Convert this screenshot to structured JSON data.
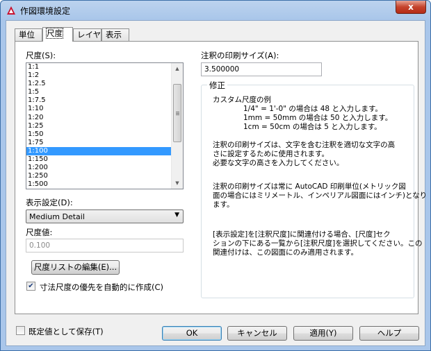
{
  "window": {
    "title": "作図環境設定",
    "close_glyph": "x"
  },
  "tabs": [
    {
      "label": "単位"
    },
    {
      "label": "尺度"
    },
    {
      "label": "レイヤ"
    },
    {
      "label": "表示"
    }
  ],
  "scale": {
    "label": "尺度(S):",
    "items": [
      "1:1",
      "1:2",
      "1:2.5",
      "1:5",
      "1:7.5",
      "1:10",
      "1:20",
      "1:25",
      "1:50",
      "1:75",
      "1:100",
      "1:150",
      "1:200",
      "1:250",
      "1:500"
    ],
    "selected": "1:100"
  },
  "display": {
    "label": "表示設定(D):",
    "value": "Medium Detail"
  },
  "scale_value": {
    "label": "尺度値:",
    "value": "0.100"
  },
  "edit_scale_list_button": "尺度リストの編集(E)...",
  "auto_dimscale": {
    "label": "寸法尺度の優先を自動的に作成(C)",
    "checked": true
  },
  "annotation_size": {
    "label": "注釈の印刷サイズ(A):",
    "value": "3.500000"
  },
  "modify": {
    "title": "修正",
    "example_title": "カスタム尺度の例",
    "example_1": "1/4\" = 1'-0\" の場合は 48 と入力します。",
    "example_2": "1mm = 50mm の場合は 50 と入力します。",
    "example_3": "1cm = 50cm の場合は 5 と入力します。",
    "para1_l1": "注釈の印刷サイズは、文字を含む注釈を適切な文字の高",
    "para1_l2": "さに設定するために使用されます。",
    "para1_l3": "必要な文字の高さを入力してください。",
    "para2_l1": "注釈の印刷サイズは常に AutoCAD 印刷単位(メトリック図",
    "para2_l2": "面の場合にはミリメートル、インペリアル図面にはインチ)となり",
    "para2_l3": "ます。",
    "para3_l1": "[表示設定]を[注釈尺度]に関連付ける場合、[尺度]セク",
    "para3_l2": "ションの下にある一覧から[注釈尺度]を選択してください。この",
    "para3_l3": "関連付けは、この図面にのみ適用されます。"
  },
  "save_default": {
    "label": "既定値として保存(T)",
    "checked": false
  },
  "buttons": {
    "ok": "OK",
    "cancel": "キャンセル",
    "apply": "適用(Y)",
    "help": "ヘルプ"
  }
}
